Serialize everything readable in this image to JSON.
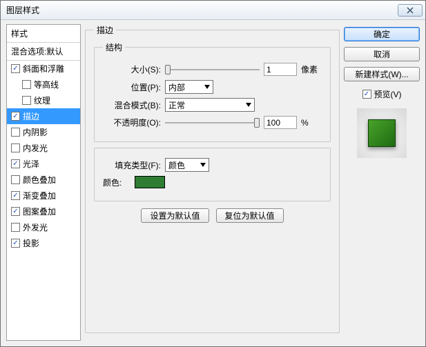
{
  "window": {
    "title": "图层样式"
  },
  "left": {
    "header": "样式",
    "blendOptions": "混合选项:默认",
    "items": [
      {
        "label": "斜面和浮雕",
        "checked": true,
        "indent": false,
        "selected": false
      },
      {
        "label": "等高线",
        "checked": false,
        "indent": true,
        "selected": false
      },
      {
        "label": "纹理",
        "checked": false,
        "indent": true,
        "selected": false
      },
      {
        "label": "描边",
        "checked": true,
        "indent": false,
        "selected": true
      },
      {
        "label": "内阴影",
        "checked": false,
        "indent": false,
        "selected": false
      },
      {
        "label": "内发光",
        "checked": false,
        "indent": false,
        "selected": false
      },
      {
        "label": "光泽",
        "checked": true,
        "indent": false,
        "selected": false
      },
      {
        "label": "颜色叠加",
        "checked": false,
        "indent": false,
        "selected": false
      },
      {
        "label": "渐变叠加",
        "checked": true,
        "indent": false,
        "selected": false
      },
      {
        "label": "图案叠加",
        "checked": true,
        "indent": false,
        "selected": false
      },
      {
        "label": "外发光",
        "checked": false,
        "indent": false,
        "selected": false
      },
      {
        "label": "投影",
        "checked": true,
        "indent": false,
        "selected": false
      }
    ]
  },
  "middle": {
    "groupTitle": "描边",
    "structure": {
      "title": "结构",
      "sizeLabel": "大小(S):",
      "sizeValue": "1",
      "sizeUnit": "像素",
      "positionLabel": "位置(P):",
      "positionValue": "内部",
      "blendModeLabel": "混合模式(B):",
      "blendModeValue": "正常",
      "opacityLabel": "不透明度(O):",
      "opacityValue": "100",
      "opacityUnit": "%"
    },
    "fill": {
      "fillTypeLabel": "填充类型(F):",
      "fillTypeValue": "颜色",
      "colorLabel": "颜色:",
      "colorValue": "#2e7d32"
    },
    "buttons": {
      "makeDefault": "设置为默认值",
      "resetDefault": "复位为默认值"
    }
  },
  "right": {
    "ok": "确定",
    "cancel": "取消",
    "newStyle": "新建样式(W)...",
    "preview": "预览(V)"
  }
}
